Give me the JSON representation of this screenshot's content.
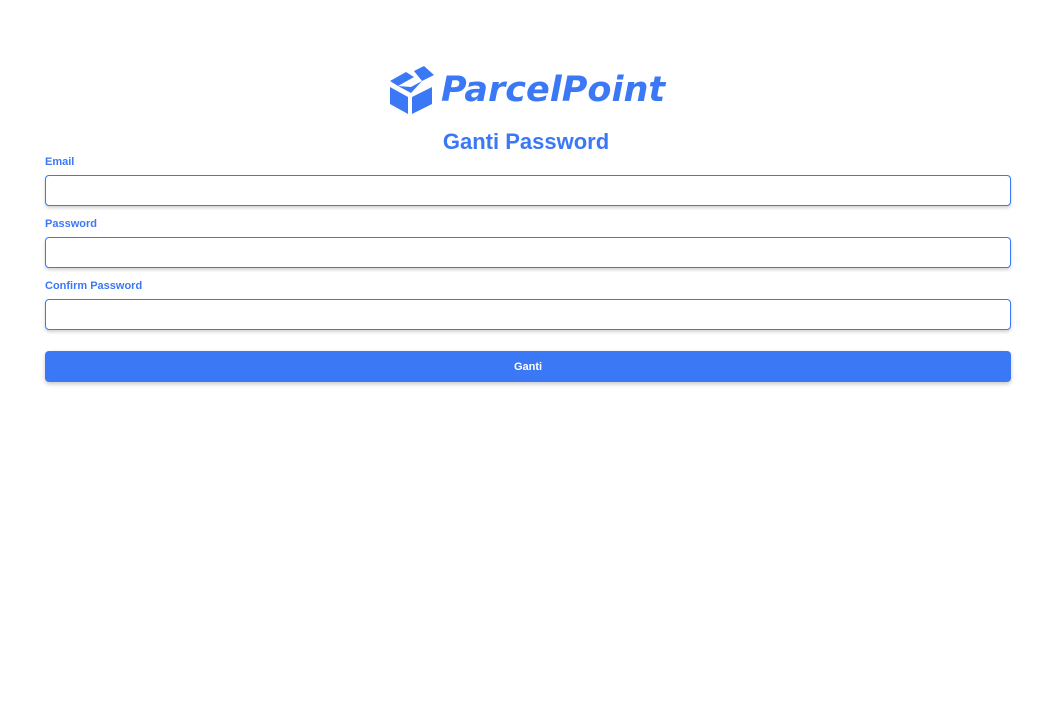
{
  "colors": {
    "accent": "#3b78f6",
    "background": "#ffffff",
    "button_text": "#ffffff"
  },
  "brand": {
    "icon": "package-box-icon",
    "name": "ParcelPoint"
  },
  "page": {
    "title": "Ganti Password"
  },
  "form": {
    "fields": [
      {
        "label": "Email",
        "value": "",
        "placeholder": ""
      },
      {
        "label": "Password",
        "value": "",
        "placeholder": ""
      },
      {
        "label": "Confirm Password",
        "value": "",
        "placeholder": ""
      }
    ],
    "submit_label": "Ganti"
  }
}
